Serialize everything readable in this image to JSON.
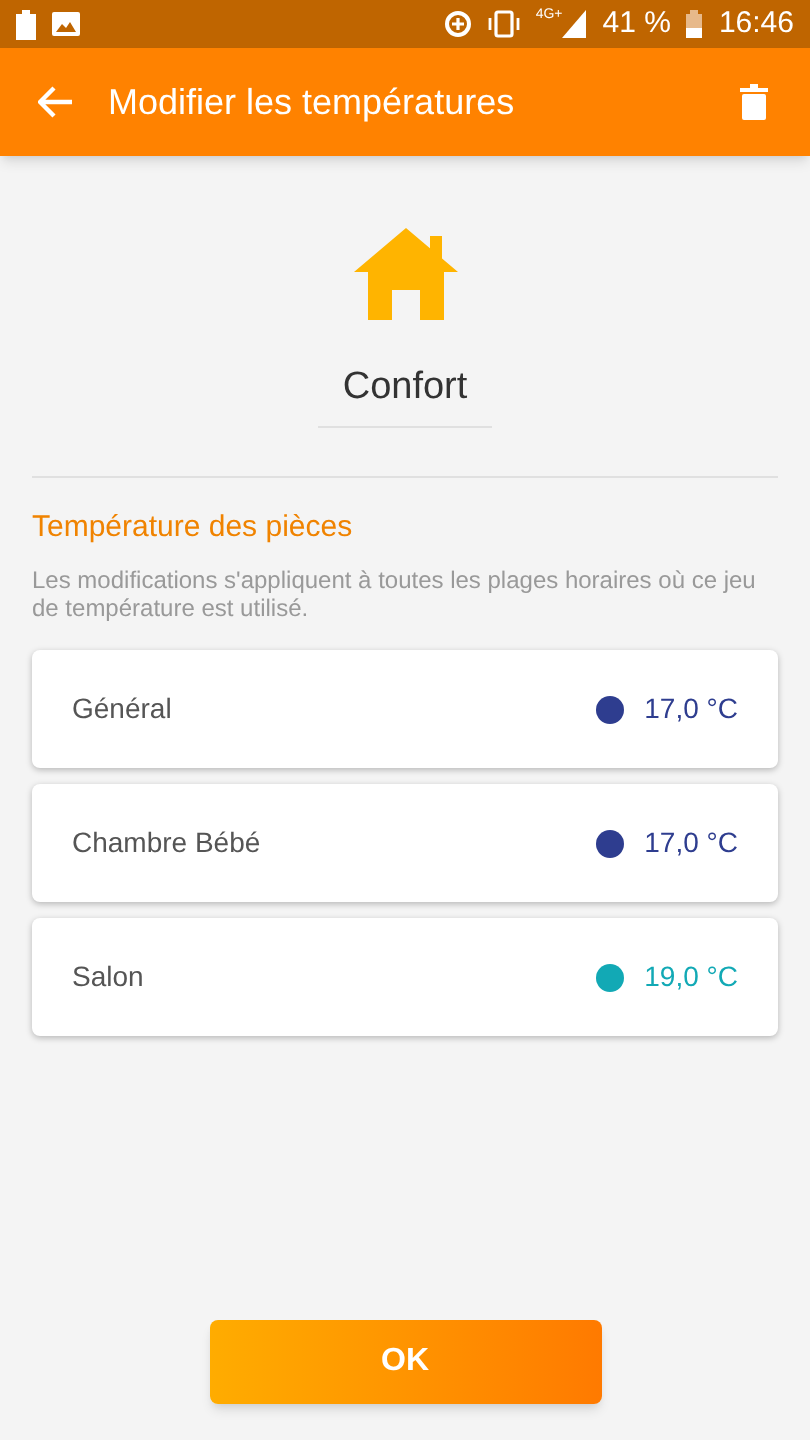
{
  "status_bar": {
    "network": "4G+",
    "battery": "41 %",
    "time": "16:46"
  },
  "app_bar": {
    "title": "Modifier les températures"
  },
  "preset": {
    "name": "Confort"
  },
  "section": {
    "title": "Température des pièces",
    "description": "Les modifications s'appliquent à toutes les plages horaires où ce jeu de température est utilisé."
  },
  "rooms": [
    {
      "name": "Général",
      "temperature": "17,0 °C",
      "color": "#2e3d8f"
    },
    {
      "name": "Chambre Bébé",
      "temperature": "17,0 °C",
      "color": "#2e3d8f"
    },
    {
      "name": "Salon",
      "temperature": "19,0 °C",
      "color": "#12a9b5"
    }
  ],
  "ok_button": "OK"
}
